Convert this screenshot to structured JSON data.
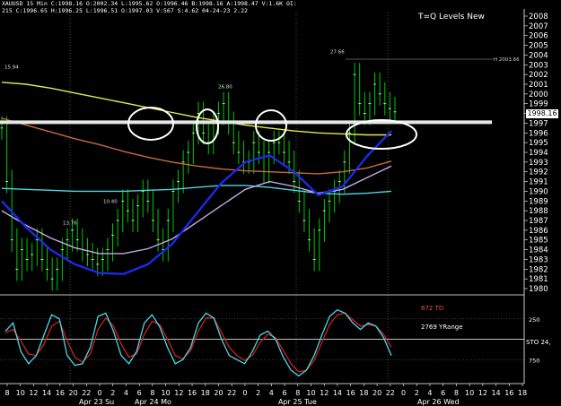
{
  "header": {
    "line1": "XAUUSD 15 Min  C:1998.16  O:2002.34  L:1995.62  O:1996.46  B:1998.16  A:1998.47  V:1.6K  OI:",
    "line2": "215  C:1996.65  H:1996.25  L:1996.51  O:1997.03  V:567  S:4.62  04-24-23  2.22"
  },
  "chart_title": "T=Q Levels New",
  "current_price": "1998.16",
  "indicator_labels": {
    "td": "672 TD",
    "yrange": "2769 YRange",
    "sto": "STO 24,"
  },
  "colors": {
    "background": "#000000",
    "candle": "#00c800",
    "grid": "#7a7a7a",
    "ma_yellow": "#e8e84a",
    "ma_orange": "#c86a3a",
    "ma_lilac": "#c8a8e8",
    "ma_cyan": "#4ad8e8",
    "ma_blue": "#1a2ae8",
    "level_line": "#e6e6e6",
    "osc_fast": "#4ad8e8",
    "osc_slow": "#d02020",
    "td_text": "#e85050"
  },
  "chart_data": {
    "type": "line",
    "title": "T=Q Levels New",
    "ylim": [
      1980,
      2008
    ],
    "yticks": [
      1980,
      1981,
      1982,
      1983,
      1984,
      1985,
      1986,
      1987,
      1988,
      1989,
      1990,
      1991,
      1992,
      1993,
      1994,
      1995,
      1996,
      1997,
      1998,
      1999,
      2000,
      2001,
      2002,
      2003,
      2004,
      2005,
      2006,
      2007,
      2008
    ],
    "oscillator_ticks": [
      "250",
      "750"
    ],
    "xtick_labels": [
      "8",
      "10",
      "12",
      "14",
      "16",
      "20",
      "22",
      "0",
      "2",
      "4",
      "6",
      "8",
      "10",
      "12",
      "16",
      "18",
      "20",
      "22",
      "0",
      "2",
      "4",
      "6",
      "8",
      "10",
      "12",
      "14",
      "16",
      "18",
      "20",
      "22",
      "0",
      "2",
      "4",
      "6",
      "8",
      "10",
      "12",
      "14",
      "16",
      "18"
    ],
    "date_labels": [
      "Apr 23 Su",
      "Apr 24 Mo",
      "Apr 25 Tue",
      "Apr 26 Wed"
    ],
    "annotations": [
      "15.94",
      "13.76",
      "10.40",
      "26.80",
      "27.66",
      "H 2003.66"
    ],
    "level_line": 1997.1,
    "close_series": [
      1996.5,
      1991,
      1985,
      1982,
      1984,
      1983,
      1983.5,
      1985,
      1983,
      1982,
      1981,
      1982,
      1984,
      1985,
      1986,
      1985,
      1984,
      1983.5,
      1983,
      1982.5,
      1983,
      1984,
      1985.5,
      1987,
      1989,
      1988,
      1987,
      1988.5,
      1990,
      1989,
      1987,
      1985,
      1984,
      1987,
      1990,
      1991,
      1993,
      1994,
      1996,
      1998,
      1996,
      1995,
      1997,
      1998,
      1999,
      1997,
      1995,
      1994,
      1993,
      1993,
      1995,
      1994,
      1992,
      1994,
      1995,
      1995,
      1994,
      1993,
      1991,
      1989,
      1987,
      1985,
      1983,
      1986,
      1988,
      1989,
      1990,
      1991,
      1993,
      1996,
      2002,
      1999,
      1998,
      1999,
      2001,
      2000,
      1999,
      1998.5,
      1998.16
    ],
    "series": [
      {
        "color": "yellow",
        "values": [
          2001.2,
          2001,
          2000.6,
          2000.1,
          1999.6,
          1999.1,
          1998.6,
          1998.1,
          1997.6,
          1997.2,
          1996.8,
          1996.5,
          1996.2,
          1996.0,
          1995.9,
          1995.8,
          1995.8
        ]
      },
      {
        "color": "orange",
        "values": [
          1997.5,
          1996.8,
          1996.1,
          1995.4,
          1994.8,
          1994.1,
          1993.5,
          1993.0,
          1992.6,
          1992.3,
          1992.1,
          1992.0,
          1991.9,
          1991.8,
          1992.0,
          1992.4,
          1993.1
        ]
      },
      {
        "color": "cyan",
        "values": [
          1990.3,
          1990.2,
          1990.1,
          1990.0,
          1990.0,
          1990.0,
          1990.1,
          1990.2,
          1990.4,
          1990.6,
          1990.6,
          1990.4,
          1990.1,
          1989.8,
          1989.7,
          1989.8,
          1990.0
        ]
      },
      {
        "color": "lilac",
        "values": [
          1988.0,
          1986.5,
          1985.2,
          1984.2,
          1983.6,
          1983.6,
          1984.1,
          1985.1,
          1986.8,
          1988.5,
          1990.2,
          1991.0,
          1990.5,
          1989.8,
          1990.2,
          1991.4,
          1992.6
        ]
      },
      {
        "color": "blue",
        "values": [
          1989.0,
          1986.3,
          1984.0,
          1982.5,
          1981.6,
          1981.5,
          1982.5,
          1984.6,
          1987.7,
          1990.8,
          1993.0,
          1993.7,
          1992.0,
          1989.6,
          1990.5,
          1993.6,
          1996.2
        ]
      }
    ],
    "oscillator_fast": [
      60,
      70,
      35,
      20,
      30,
      55,
      80,
      75,
      30,
      18,
      20,
      40,
      78,
      82,
      60,
      30,
      20,
      35,
      70,
      80,
      65,
      40,
      20,
      25,
      40,
      70,
      82,
      76,
      50,
      30,
      25,
      20,
      35,
      55,
      60,
      50,
      28,
      12,
      5,
      12,
      30,
      55,
      78,
      86,
      82,
      70,
      62,
      70,
      66,
      52,
      30
    ],
    "oscillator_slow": [
      58,
      62,
      48,
      32,
      30,
      44,
      66,
      72,
      48,
      28,
      22,
      32,
      62,
      76,
      66,
      44,
      28,
      32,
      56,
      72,
      68,
      50,
      30,
      26,
      36,
      60,
      76,
      76,
      58,
      40,
      30,
      24,
      30,
      46,
      56,
      52,
      36,
      20,
      10,
      12,
      24,
      46,
      68,
      80,
      82,
      74,
      66,
      68,
      66,
      56,
      40
    ]
  }
}
